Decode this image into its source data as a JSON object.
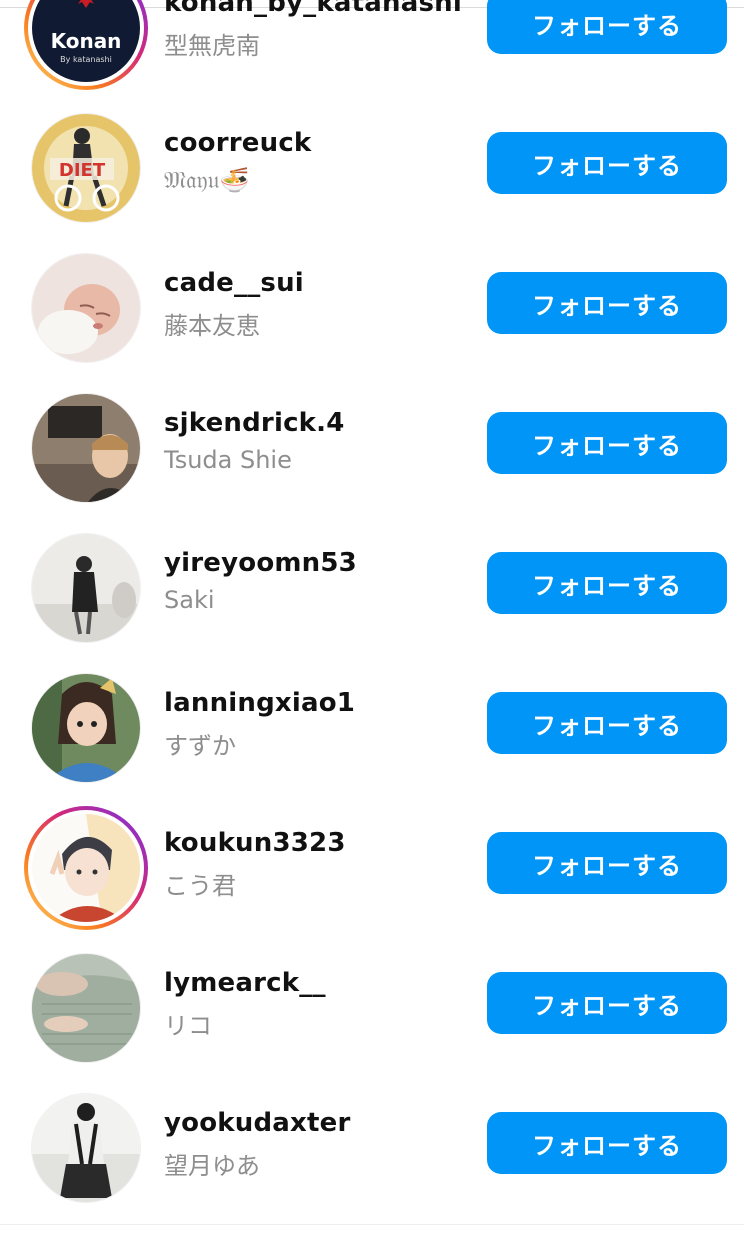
{
  "suggestions": [
    {
      "username": "konan_by_katanashi",
      "fullname": "型無虎南",
      "follow_label": "フォローする",
      "has_story": true
    },
    {
      "username": "coorreuck",
      "fullname": "𝔐𝔞𝔶𝔲🍜",
      "follow_label": "フォローする",
      "has_story": false
    },
    {
      "username": "cade__sui",
      "fullname": "藤本友恵",
      "follow_label": "フォローする",
      "has_story": false
    },
    {
      "username": "sjkendrick.4",
      "fullname": "Tsuda Shie",
      "follow_label": "フォローする",
      "has_story": false
    },
    {
      "username": "yireyoomn53",
      "fullname": "Saki",
      "follow_label": "フォローする",
      "has_story": false
    },
    {
      "username": "lanningxiao1",
      "fullname": "すずか",
      "follow_label": "フォローする",
      "has_story": false
    },
    {
      "username": "koukun3323",
      "fullname": "こう君",
      "follow_label": "フォローする",
      "has_story": true
    },
    {
      "username": "lymearck__",
      "fullname": "リコ",
      "follow_label": "フォローする",
      "has_story": false
    },
    {
      "username": "yookudaxter",
      "fullname": "望月ゆあ",
      "follow_label": "フォローする",
      "has_story": false
    }
  ],
  "avatar_logo": {
    "brand": "Konan",
    "sub": "By katanashi"
  },
  "avatar_sign": {
    "text": "DIET"
  },
  "colors": {
    "follow_button": "#0095f6",
    "username": "#111111",
    "fullname": "#8e8e8e"
  }
}
